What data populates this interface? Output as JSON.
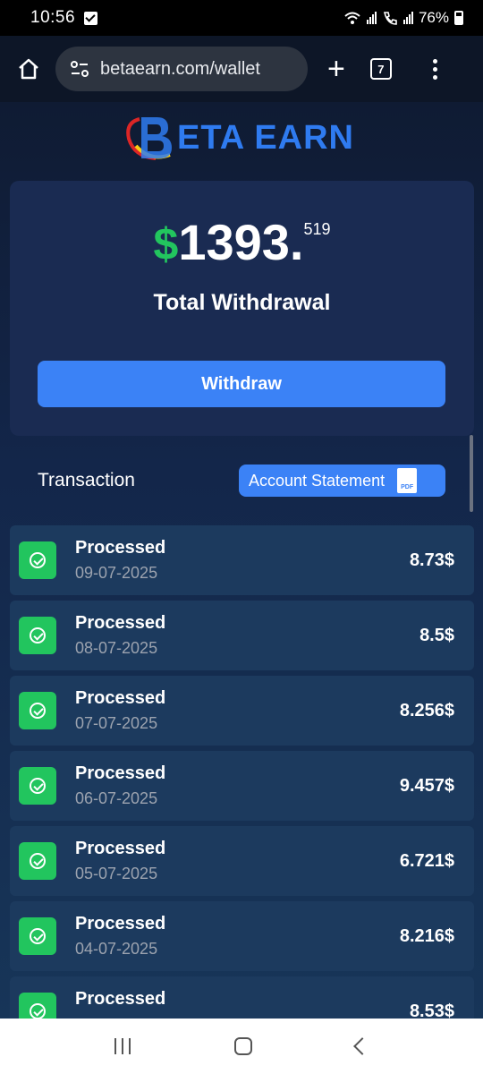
{
  "status_bar": {
    "time": "10:56",
    "battery": "76%"
  },
  "browser": {
    "url": "betaearn.com/wallet",
    "tab_count": "7"
  },
  "logo": {
    "text": "ETA EARN"
  },
  "wallet": {
    "currency_symbol": "$",
    "amount_main": "1393.",
    "amount_decimals": "519",
    "total_label": "Total Withdrawal",
    "withdraw_button": "Withdraw"
  },
  "transactions_header": {
    "title": "Transaction",
    "statement_button": "Account Statement",
    "pdf_label": "PDF"
  },
  "transactions": [
    {
      "status": "Processed",
      "date": "09-07-2025",
      "amount": "8.73$"
    },
    {
      "status": "Processed",
      "date": "08-07-2025",
      "amount": "8.5$"
    },
    {
      "status": "Processed",
      "date": "07-07-2025",
      "amount": "8.256$"
    },
    {
      "status": "Processed",
      "date": "06-07-2025",
      "amount": "9.457$"
    },
    {
      "status": "Processed",
      "date": "05-07-2025",
      "amount": "6.721$"
    },
    {
      "status": "Processed",
      "date": "04-07-2025",
      "amount": "8.216$"
    },
    {
      "status": "Processed",
      "date": "",
      "amount": "8.53$"
    }
  ],
  "colors": {
    "accent": "#3b82f6",
    "success": "#22c55e",
    "card": "#1a2b52"
  }
}
